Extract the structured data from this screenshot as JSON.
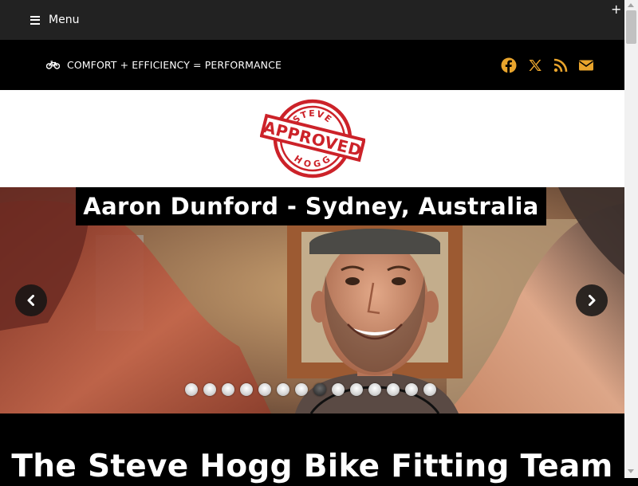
{
  "menubar": {
    "menu_label": "Menu",
    "plus": "+"
  },
  "tagline": {
    "text": "COMFORT + EFFICIENCY = PERFORMANCE",
    "icon": "bicycle-icon"
  },
  "social": {
    "color": "#e8a42c",
    "items": [
      "facebook-icon",
      "x-icon",
      "rss-icon",
      "email-icon"
    ]
  },
  "logo": {
    "top_word": "STEVE",
    "band_word": "APPROVED",
    "bottom_word": "HOGG",
    "color": "#cc2229"
  },
  "slider": {
    "title": "Aaron Dunford - Sydney, Australia",
    "slide_count": 14,
    "active_slide": 8
  },
  "main": {
    "heading": "The Steve Hogg Bike Fitting Team"
  }
}
